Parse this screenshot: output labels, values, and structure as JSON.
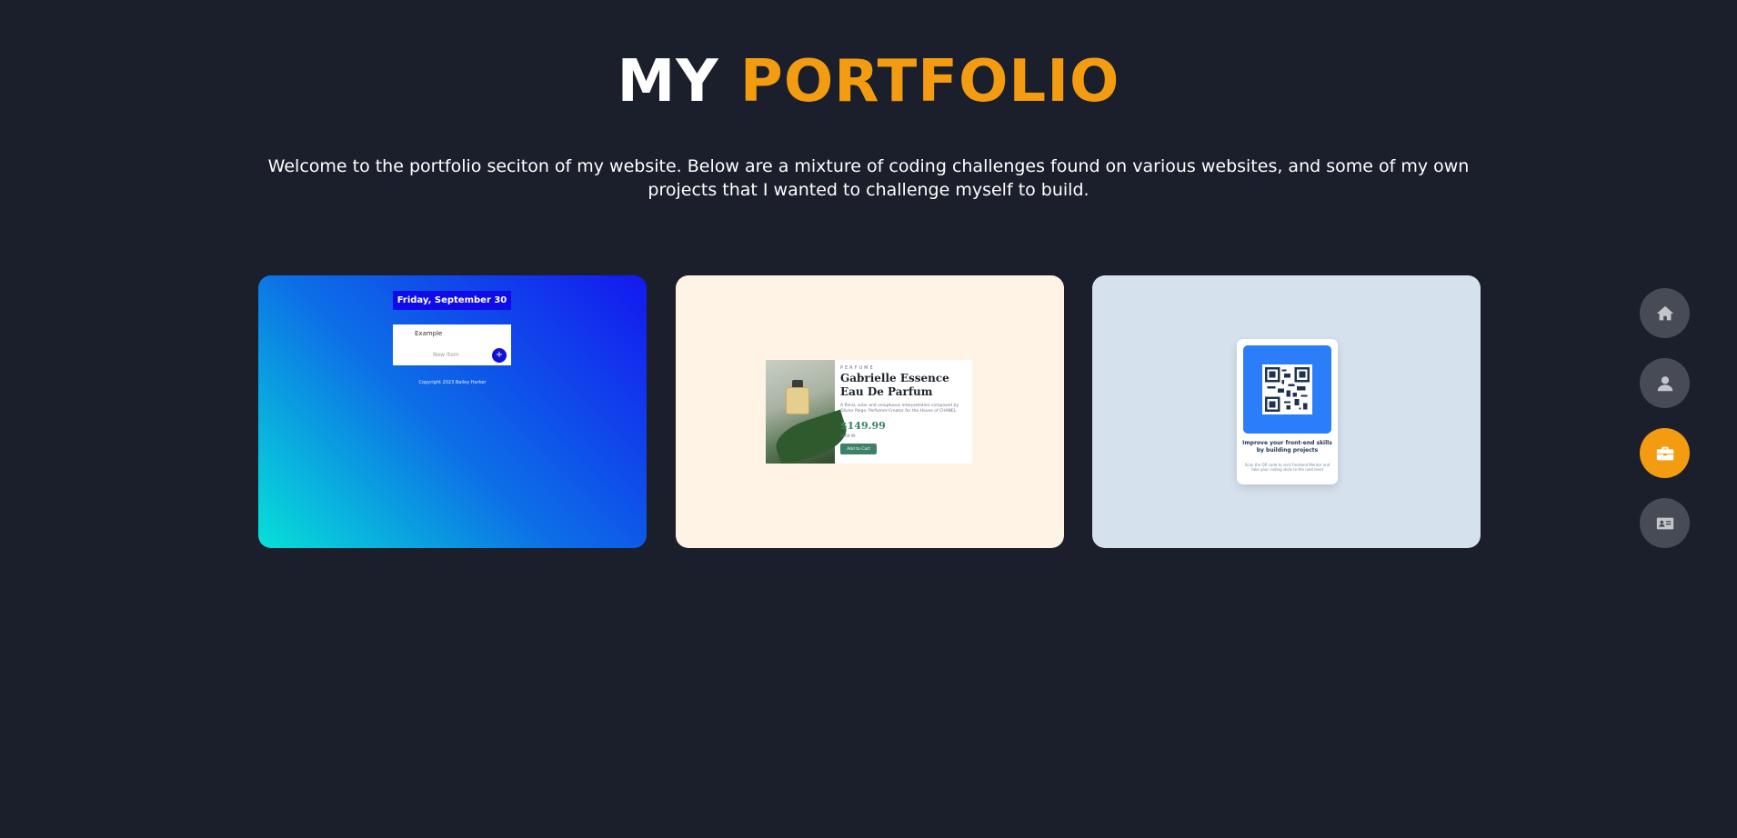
{
  "header": {
    "title_plain": "MY",
    "title_accent": "PORTFOLIO",
    "intro": "Welcome to the portfolio seciton of my website. Below are a mixture of coding challenges found on various websites, and some of my own projects that I wanted to challenge myself to build."
  },
  "projects": [
    {
      "kind": "todo",
      "date": "Friday, September 30",
      "item": "Example",
      "new_placeholder": "New Item",
      "add_symbol": "+",
      "copyright": "Copyright 2023 Bailey Harker"
    },
    {
      "kind": "perfume",
      "category": "PERFUME",
      "name": "Gabrielle Essence Eau De Parfum",
      "description": "A floral, solar and voluptuous interpretation composed by Olivier Polge, Perfumer-Creator for the House of CHANEL.",
      "price": "$149.99",
      "old_price": "$169.99",
      "button": "Add to Cart"
    },
    {
      "kind": "qr",
      "title": "Improve your front-end skills by building projects",
      "text": "Scan the QR code to visit Frontend Mentor and take your coding skills to the next level"
    }
  ],
  "nav": {
    "items": [
      {
        "name": "home",
        "icon": "home-icon",
        "active": false
      },
      {
        "name": "about",
        "icon": "user-icon",
        "active": false
      },
      {
        "name": "portfolio",
        "icon": "briefcase-icon",
        "active": true
      },
      {
        "name": "contact",
        "icon": "id-card-icon",
        "active": false
      }
    ]
  },
  "colors": {
    "background": "#1b1e2b",
    "accent": "#f39c12",
    "nav_button": "#474b55"
  }
}
